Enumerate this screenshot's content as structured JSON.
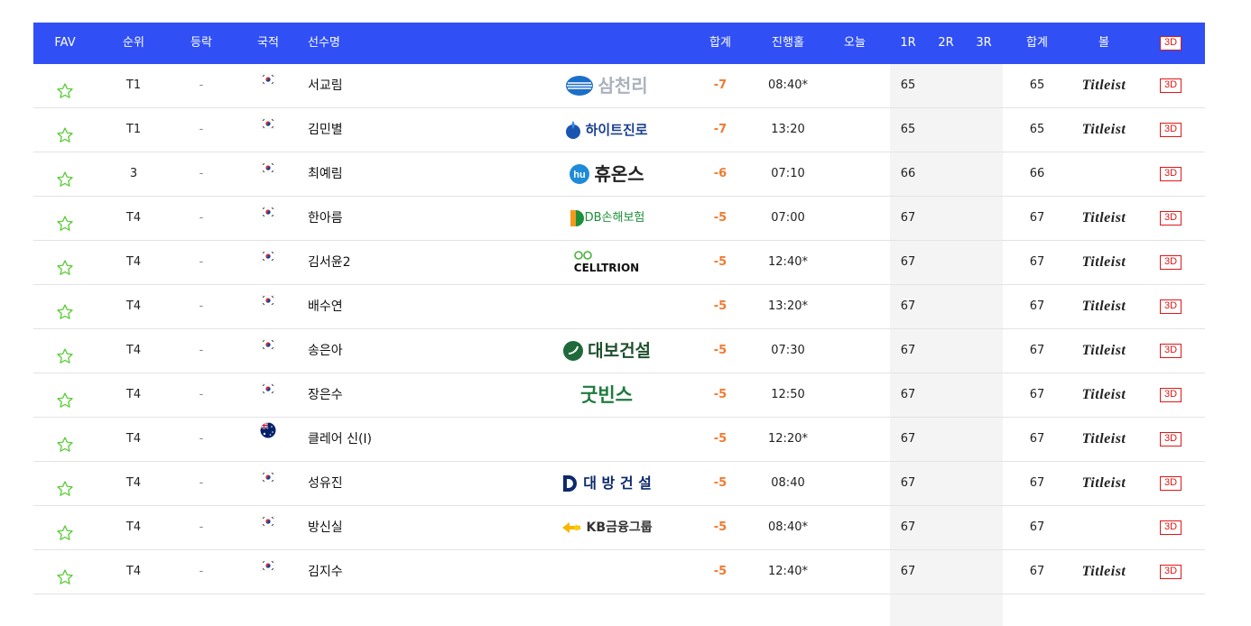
{
  "header": {
    "fav": "FAV",
    "rank": "순위",
    "move": "등락",
    "nat": "국적",
    "name": "선수명",
    "total": "합계",
    "thru": "진행홀",
    "today": "오늘",
    "r1": "1R",
    "r2": "2R",
    "r3": "3R",
    "sum": "합계",
    "ball": "볼",
    "btn3d": "3D"
  },
  "colors": {
    "header_bg": "#3050f5",
    "score": "#f07a30",
    "star": "#5ccd3a",
    "btn3d": "#e01818"
  },
  "rows": [
    {
      "rank": "T1",
      "move": "-",
      "nat": "KOR",
      "name": "서교림",
      "sponsor": "삼천리",
      "sponsor_icon": "samchully-logo",
      "total": "-7",
      "thru": "08:40*",
      "r1": "65",
      "sum": "65",
      "ball": "Titleist",
      "btn3d": "3D"
    },
    {
      "rank": "T1",
      "move": "-",
      "nat": "KOR",
      "name": "김민별",
      "sponsor": "하이트진로",
      "sponsor_icon": "hitejinro-logo",
      "total": "-7",
      "thru": "13:20",
      "r1": "65",
      "sum": "65",
      "ball": "Titleist",
      "btn3d": "3D"
    },
    {
      "rank": "3",
      "move": "-",
      "nat": "KOR",
      "name": "최예림",
      "sponsor": "휴온스",
      "sponsor_icon": "huons-logo",
      "total": "-6",
      "thru": "07:10",
      "r1": "66",
      "sum": "66",
      "ball": "",
      "btn3d": "3D"
    },
    {
      "rank": "T4",
      "move": "-",
      "nat": "KOR",
      "name": "한아름",
      "sponsor": "DB손해보험",
      "sponsor_icon": "db-logo",
      "total": "-5",
      "thru": "07:00",
      "r1": "67",
      "sum": "67",
      "ball": "Titleist",
      "btn3d": "3D"
    },
    {
      "rank": "T4",
      "move": "-",
      "nat": "KOR",
      "name": "김서윤2",
      "sponsor": "CELLTRION",
      "sponsor_icon": "celltrion-logo",
      "total": "-5",
      "thru": "12:40*",
      "r1": "67",
      "sum": "67",
      "ball": "Titleist",
      "btn3d": "3D"
    },
    {
      "rank": "T4",
      "move": "-",
      "nat": "KOR",
      "name": "배수연",
      "sponsor": "",
      "sponsor_icon": "",
      "total": "-5",
      "thru": "13:20*",
      "r1": "67",
      "sum": "67",
      "ball": "Titleist",
      "btn3d": "3D"
    },
    {
      "rank": "T4",
      "move": "-",
      "nat": "KOR",
      "name": "송은아",
      "sponsor": "대보건설",
      "sponsor_icon": "daebo-logo",
      "total": "-5",
      "thru": "07:30",
      "r1": "67",
      "sum": "67",
      "ball": "Titleist",
      "btn3d": "3D"
    },
    {
      "rank": "T4",
      "move": "-",
      "nat": "KOR",
      "name": "장은수",
      "sponsor": "굿빈스",
      "sponsor_icon": "goodbeans-logo",
      "total": "-5",
      "thru": "12:50",
      "r1": "67",
      "sum": "67",
      "ball": "Titleist",
      "btn3d": "3D"
    },
    {
      "rank": "T4",
      "move": "-",
      "nat": "AUS",
      "name": "클레어 신(I)",
      "sponsor": "",
      "sponsor_icon": "",
      "total": "-5",
      "thru": "12:20*",
      "r1": "67",
      "sum": "67",
      "ball": "Titleist",
      "btn3d": "3D"
    },
    {
      "rank": "T4",
      "move": "-",
      "nat": "KOR",
      "name": "성유진",
      "sponsor": "대 방 건 설",
      "sponsor_icon": "daebang-logo",
      "total": "-5",
      "thru": "08:40",
      "r1": "67",
      "sum": "67",
      "ball": "Titleist",
      "btn3d": "3D"
    },
    {
      "rank": "T4",
      "move": "-",
      "nat": "KOR",
      "name": "방신실",
      "sponsor": "KB금융그룹",
      "sponsor_icon": "kb-logo",
      "total": "-5",
      "thru": "08:40*",
      "r1": "67",
      "sum": "67",
      "ball": "",
      "btn3d": "3D"
    },
    {
      "rank": "T4",
      "move": "-",
      "nat": "KOR",
      "name": "김지수",
      "sponsor": "",
      "sponsor_icon": "",
      "total": "-5",
      "thru": "12:40*",
      "r1": "67",
      "sum": "67",
      "ball": "Titleist",
      "btn3d": "3D"
    }
  ]
}
